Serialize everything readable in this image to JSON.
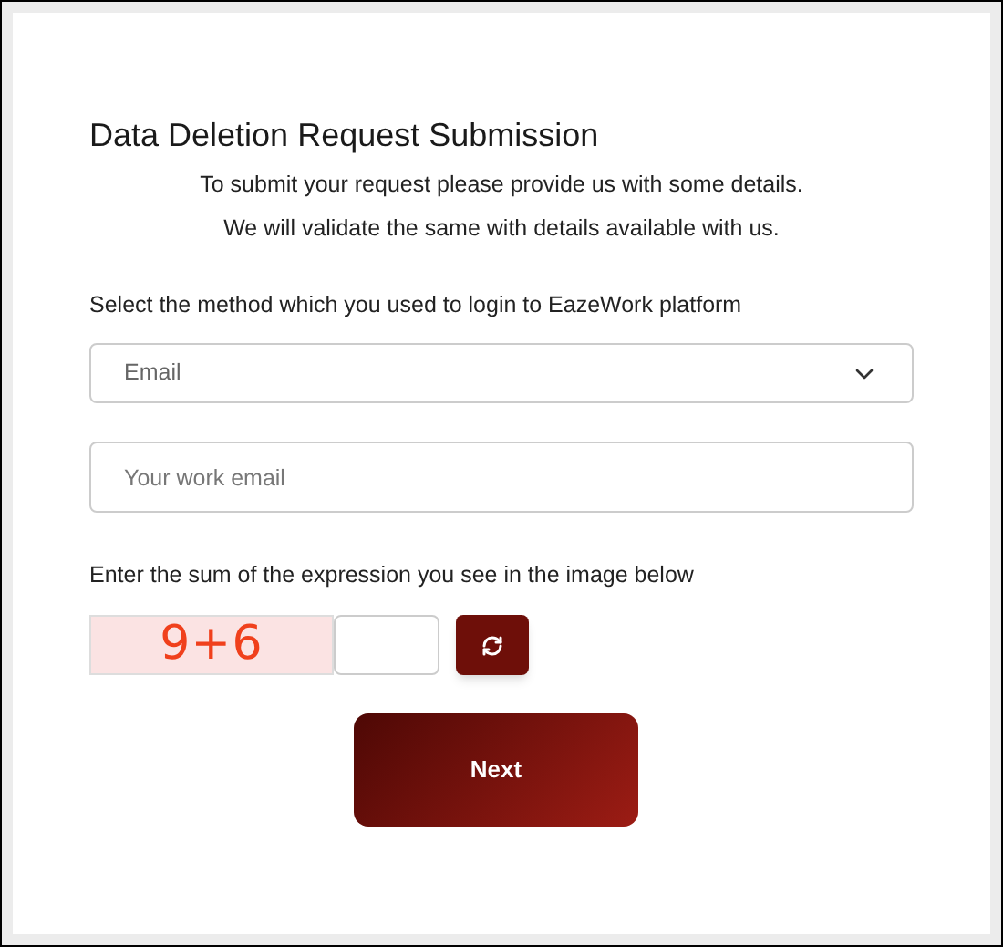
{
  "title": "Data Deletion Request Submission",
  "intro": [
    "To submit your request please provide us with some details.",
    "We will validate the same with details available with us."
  ],
  "method_label": "Select the method which you used to login to EazeWork platform",
  "method_select": {
    "value": "Email"
  },
  "email_field": {
    "placeholder": "Your work email"
  },
  "captcha_label": "Enter the sum of the expression you see in the image below",
  "captcha": {
    "expression": "9+6"
  },
  "next_button": "Next"
}
